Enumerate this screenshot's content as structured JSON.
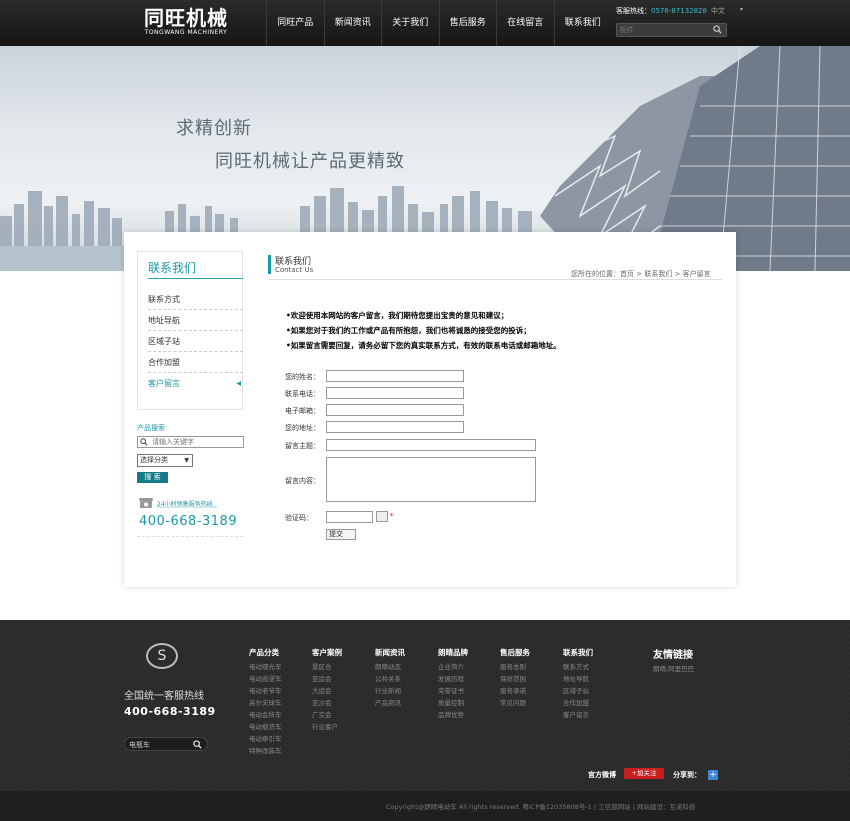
{
  "header": {
    "logo_cn": "同旺机械",
    "logo_en": "TONGWANG MACHINERY",
    "nav": [
      "同旺产品",
      "新闻资讯",
      "关于我们",
      "售后服务",
      "在线留言",
      "联系我们"
    ],
    "hotline_label": "客服热线：",
    "hotline_number": "0576-87132828",
    "lang": "中文",
    "lang_arrow": "▾",
    "search_placeholder": "配件"
  },
  "banner": {
    "slogan1": "求精创新",
    "slogan2": "同旺机械让产品更精致"
  },
  "sidebar": {
    "title": "联系我们",
    "items": [
      {
        "label": "联系方式"
      },
      {
        "label": "地址导航"
      },
      {
        "label": "区域子站"
      },
      {
        "label": "合作加盟"
      },
      {
        "label": "客户留言",
        "active": true
      }
    ],
    "product_search_title": "产品搜索",
    "product_search_placeholder": "请输入关键字",
    "category_select": "选择分类",
    "search_button": "搜 索",
    "phone_label": "24小时销售服务热线",
    "phone_number": "400-668-3189"
  },
  "main": {
    "title": "联系我们",
    "subtitle": "Contact Us",
    "breadcrumb": "您所在的位置：首页 > 联系我们 > 客户留言",
    "notices": [
      "•欢迎使用本网站的客户留言，我们期待您提出宝贵的意见和建议；",
      "•如果您对于我们的工作或产品有所抱怨，我们也将诚恳的接受您的投诉；",
      "•如果留言需要回复，请务必留下您的真实联系方式，有效的联系电话或邮箱地址。"
    ],
    "form": {
      "name_label": "您的姓名：",
      "phone_label": "联系电话：",
      "email_label": "电子邮箱：",
      "address_label": "您的地址：",
      "subject_label": "留言主题：",
      "content_label": "留言内容：",
      "captcha_label": "验证码：",
      "required_mark": "*",
      "submit_label": "提交"
    }
  },
  "footer": {
    "logo_glyph": "S",
    "hotline_title": "全国统一客服热线",
    "hotline_number": "400-668-3189",
    "search_value": "电瓶车",
    "columns": [
      {
        "title": "产品分类",
        "items": [
          "电动观光车",
          "电动巡逻车",
          "电动老爷车",
          "高尔夫球车",
          "电动会所车",
          "电动载货车",
          "电动牵引车",
          "特种改装车"
        ]
      },
      {
        "title": "客户案例",
        "items": [
          "景区合",
          "亚运会",
          "大运会",
          "亚沙会",
          "广交会",
          "行业客户"
        ]
      },
      {
        "title": "新闻资讯",
        "items": [
          "朗晴动态",
          "公共关系",
          "行业新闻",
          "产品资讯"
        ]
      },
      {
        "title": "朗晴品牌",
        "items": [
          "企业简介",
          "发展历程",
          "荣誉证书",
          "质量控制",
          "品牌优势"
        ]
      },
      {
        "title": "售后服务",
        "items": [
          "服务总则",
          "保修范围",
          "服务承诺",
          "常见问题"
        ]
      },
      {
        "title": "联系我们",
        "items": [
          "联系方式",
          "地址导航",
          "区域子站",
          "合作加盟",
          "客户留言"
        ]
      }
    ],
    "friend_title": "友情链接",
    "friend_item": "朗晴,阿里巴巴",
    "weibo_label": "官方微博",
    "weibo_button": "+加关注",
    "share_label": "分享到：",
    "copyright": "Copyright@朗晴电动车 All rights reserved. 粤ICP备12035808号-1 | 工信部网站 | 网站建设：互诺科技"
  }
}
